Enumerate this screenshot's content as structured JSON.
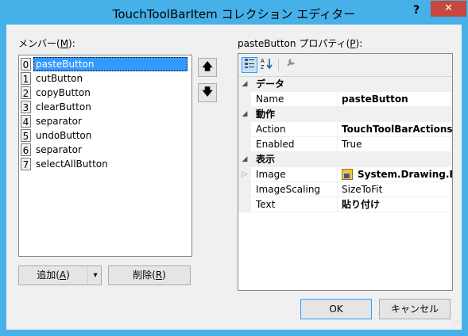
{
  "window": {
    "title": "TouchToolBarItem コレクション エディター",
    "help_label": "?",
    "close_label": "✕"
  },
  "members": {
    "label_prefix": "メンバー(",
    "label_key": "M",
    "label_suffix": "):",
    "items": [
      {
        "index": "0",
        "name": "pasteButton",
        "selected": true
      },
      {
        "index": "1",
        "name": "cutButton"
      },
      {
        "index": "2",
        "name": "copyButton"
      },
      {
        "index": "3",
        "name": "clearButton"
      },
      {
        "index": "4",
        "name": "separator"
      },
      {
        "index": "5",
        "name": "undoButton"
      },
      {
        "index": "6",
        "name": "separator"
      },
      {
        "index": "7",
        "name": "selectAllButton"
      }
    ],
    "add_prefix": "追加(",
    "add_key": "A",
    "add_suffix": ")",
    "add_dropdown": "▾",
    "remove_prefix": "削除(",
    "remove_key": "R",
    "remove_suffix": ")",
    "up_arrow": "🡅",
    "down_arrow": "🡇"
  },
  "properties": {
    "label_prefix": "pasteButton プロパティ(",
    "label_key": "P",
    "label_suffix": "):",
    "categories": [
      {
        "name": "データ",
        "rows": [
          {
            "name": "Name",
            "value": "pasteButton",
            "bold": true
          }
        ]
      },
      {
        "name": "動作",
        "rows": [
          {
            "name": "Action",
            "value": "TouchToolBarActions.",
            "bold": true
          },
          {
            "name": "Enabled",
            "value": "True"
          }
        ]
      },
      {
        "name": "表示",
        "rows": [
          {
            "name": "Image",
            "value": "System.Drawing.B",
            "bold": true,
            "expandable": true,
            "icon": "bitmap-icon"
          },
          {
            "name": "ImageScaling",
            "value": "SizeToFit"
          },
          {
            "name": "Text",
            "value": "貼り付け",
            "bold": true
          }
        ]
      }
    ]
  },
  "buttons": {
    "ok": "OK",
    "cancel": "キャンセル"
  }
}
